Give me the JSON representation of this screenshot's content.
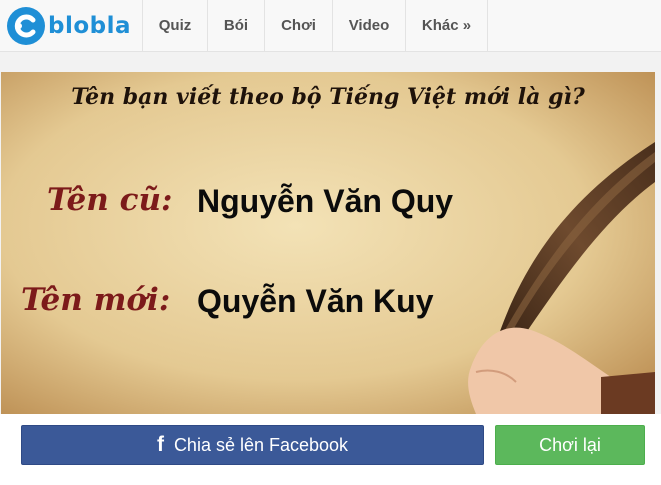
{
  "brand": {
    "name": "blobla",
    "color": "#1f8fd6"
  },
  "nav": [
    {
      "label": "Quiz"
    },
    {
      "label": "Bói"
    },
    {
      "label": "Chơi"
    },
    {
      "label": "Video"
    },
    {
      "label": "Khác »"
    }
  ],
  "result": {
    "question": "Tên bạn viết theo bộ Tiếng Việt mới là gì?",
    "old_label": "Tên cũ:",
    "old_value": "Nguyễn Văn Quy",
    "new_label": "Tên mới:",
    "new_value": "Quyễn Văn Kuy",
    "label_color": "#7c1a1a"
  },
  "actions": {
    "share_icon": "facebook-icon",
    "share_label": "Chia sẻ lên Facebook",
    "share_color": "#3b5998",
    "replay_label": "Chơi lại",
    "replay_color": "#5cb85c"
  }
}
